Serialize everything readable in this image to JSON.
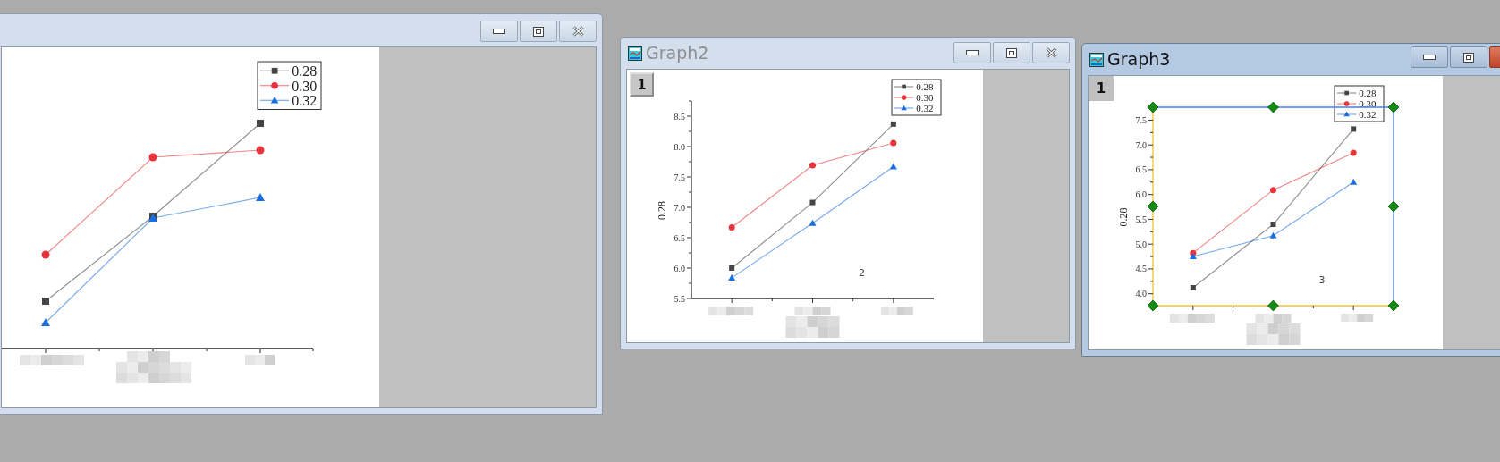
{
  "windows": [
    {
      "active": false,
      "chart": {
        "legend": [
          {
            "label": "0.28",
            "color": "#444444",
            "kind": "square"
          },
          {
            "label": "0.30",
            "color": "#e8333a",
            "kind": "circle"
          },
          {
            "label": "0.32",
            "color": "#1a6fdf",
            "kind": "triangle"
          }
        ]
      }
    },
    {
      "title": "Graph2",
      "active": false,
      "selected": false,
      "layer_button": "1",
      "chart_data": {
        "type": "line",
        "ylabel": "0.28",
        "ylim": [
          5.5,
          8.75
        ],
        "legend": "upper right",
        "yticks": [
          {
            "value": 5.5,
            "label": "5.5"
          },
          {
            "value": 6,
            "label": "6.0"
          },
          {
            "value": 6.5,
            "label": "6.5"
          },
          {
            "value": 7,
            "label": "7.0"
          },
          {
            "value": 7.5,
            "label": "7.5"
          },
          {
            "value": 8,
            "label": "8.0"
          },
          {
            "value": 8.5,
            "label": "8.5"
          }
        ],
        "series": [
          {
            "name": "0.28",
            "color": "#444444",
            "marker": "square",
            "values": [
              6.0,
              7.08,
              8.37
            ]
          },
          {
            "name": "0.30",
            "color": "#e8333a",
            "marker": "circle",
            "values": [
              6.67,
              7.69,
              8.06
            ]
          },
          {
            "name": "0.32",
            "color": "#1a6fdf",
            "marker": "triangle",
            "values": [
              5.84,
              6.74,
              7.67
            ]
          }
        ],
        "annotations": [
          {
            "text": "2"
          }
        ]
      }
    },
    {
      "title": "Graph3",
      "active": true,
      "selected": true,
      "layer_button": "1",
      "chart_data": {
        "type": "line",
        "ylabel": "0.28",
        "ylim": [
          3.76,
          7.76
        ],
        "legend": "upper right",
        "yticks": [
          {
            "value": 4,
            "label": "4.0"
          },
          {
            "value": 4.5,
            "label": "4.5"
          },
          {
            "value": 5,
            "label": "5.0"
          },
          {
            "value": 5.5,
            "label": "5.5"
          },
          {
            "value": 6,
            "label": "6.0"
          },
          {
            "value": 6.5,
            "label": "6.5"
          },
          {
            "value": 7,
            "label": "7.0"
          },
          {
            "value": 7.5,
            "label": "7.5"
          }
        ],
        "series": [
          {
            "name": "0.28",
            "color": "#444444",
            "marker": "square",
            "values": [
              4.12,
              5.4,
              7.32
            ]
          },
          {
            "name": "0.30",
            "color": "#e8333a",
            "marker": "circle",
            "values": [
              4.82,
              6.09,
              6.84
            ]
          },
          {
            "name": "0.32",
            "color": "#1a6fdf",
            "marker": "triangle",
            "values": [
              4.75,
              5.17,
              6.25
            ]
          }
        ],
        "annotations": [
          {
            "text": "3"
          }
        ]
      }
    }
  ]
}
